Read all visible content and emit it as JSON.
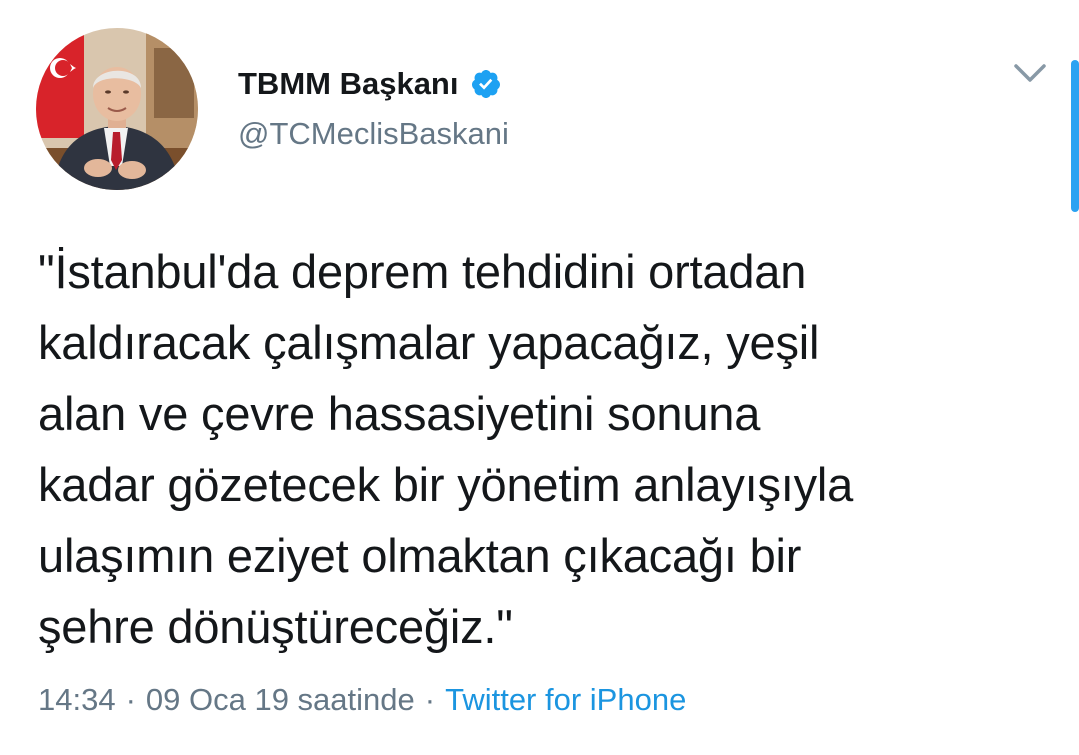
{
  "tweet": {
    "author": {
      "display_name": "TBMM Başkanı",
      "handle": "@TCMeclisBaskani",
      "verified": true
    },
    "text_lines": [
      "\"İstanbul'da deprem tehdidini ortadan",
      "kaldıracak çalışmalar yapacağız, yeşil",
      "alan ve çevre hassasiyetini sonuna",
      "kadar gözetecek bir yönetim anlayışıyla",
      "ulaşımın eziyet olmaktan çıkacağı bir",
      "şehre dönüştüreceğiz.\""
    ],
    "meta": {
      "time": "14:34",
      "separator": "·",
      "date": "09 Oca 19 saatinde",
      "source": "Twitter for iPhone"
    }
  },
  "icons": {
    "verified": "verified-badge-icon",
    "menu": "chevron-down-icon"
  },
  "colors": {
    "text": "#14171a",
    "secondary": "#657786",
    "link": "#1b95e0",
    "verified": "#1da1f2",
    "scrollbar": "#2ba2f2"
  }
}
